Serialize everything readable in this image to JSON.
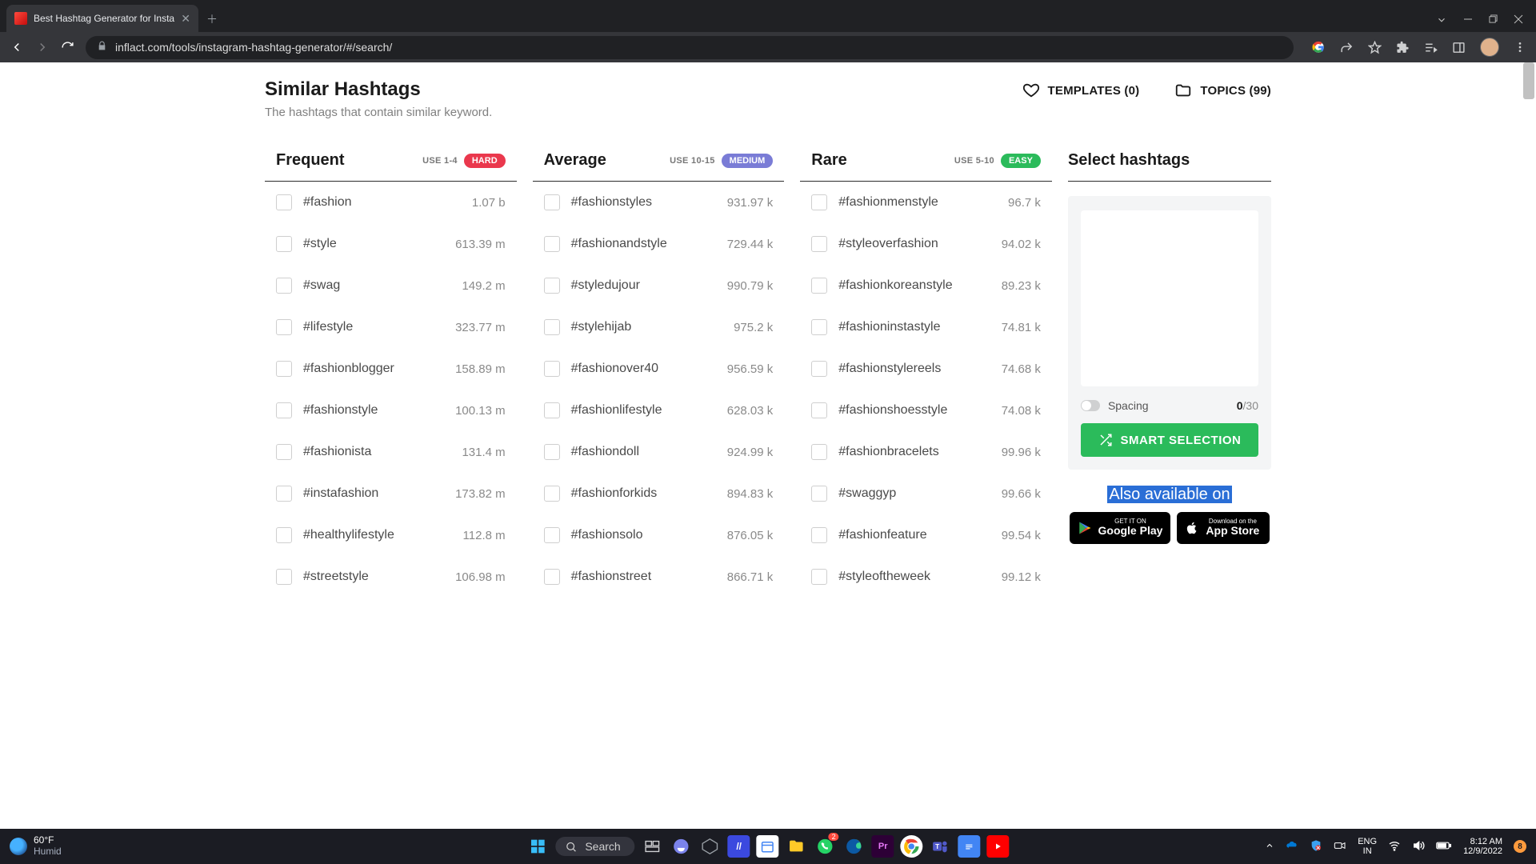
{
  "browser": {
    "tab_title": "Best Hashtag Generator for Insta",
    "url": "inflact.com/tools/instagram-hashtag-generator/#/search/"
  },
  "header": {
    "title": "Similar Hashtags",
    "subtitle": "The hashtags that contain similar keyword.",
    "templates_label": "TEMPLATES (0)",
    "topics_label": "TOPICS (99)"
  },
  "columns": {
    "frequent": {
      "title": "Frequent",
      "use": "USE 1-4",
      "badge": "HARD",
      "items": [
        {
          "tag": "#fashion",
          "count": "1.07 b"
        },
        {
          "tag": "#style",
          "count": "613.39 m"
        },
        {
          "tag": "#swag",
          "count": "149.2 m"
        },
        {
          "tag": "#lifestyle",
          "count": "323.77 m"
        },
        {
          "tag": "#fashionblogger",
          "count": "158.89 m"
        },
        {
          "tag": "#fashionstyle",
          "count": "100.13 m"
        },
        {
          "tag": "#fashionista",
          "count": "131.4 m"
        },
        {
          "tag": "#instafashion",
          "count": "173.82 m"
        },
        {
          "tag": "#healthylifestyle",
          "count": "112.8 m"
        },
        {
          "tag": "#streetstyle",
          "count": "106.98 m"
        }
      ]
    },
    "average": {
      "title": "Average",
      "use": "USE 10-15",
      "badge": "MEDIUM",
      "items": [
        {
          "tag": "#fashionstyles",
          "count": "931.97 k"
        },
        {
          "tag": "#fashionandstyle",
          "count": "729.44 k"
        },
        {
          "tag": "#styledujour",
          "count": "990.79 k"
        },
        {
          "tag": "#stylehijab",
          "count": "975.2 k"
        },
        {
          "tag": "#fashionover40",
          "count": "956.59 k"
        },
        {
          "tag": "#fashionlifestyle",
          "count": "628.03 k"
        },
        {
          "tag": "#fashiondoll",
          "count": "924.99 k"
        },
        {
          "tag": "#fashionforkids",
          "count": "894.83 k"
        },
        {
          "tag": "#fashionsolo",
          "count": "876.05 k"
        },
        {
          "tag": "#fashionstreet",
          "count": "866.71 k"
        }
      ]
    },
    "rare": {
      "title": "Rare",
      "use": "USE 5-10",
      "badge": "EASY",
      "items": [
        {
          "tag": "#fashionmenstyle",
          "count": "96.7 k"
        },
        {
          "tag": "#styleoverfashion",
          "count": "94.02 k"
        },
        {
          "tag": "#fashionkoreanstyle",
          "count": "89.23 k"
        },
        {
          "tag": "#fashioninstastyle",
          "count": "74.81 k"
        },
        {
          "tag": "#fashionstylereels",
          "count": "74.68 k"
        },
        {
          "tag": "#fashionshoesstyle",
          "count": "74.08 k"
        },
        {
          "tag": "#fashionbracelets",
          "count": "99.96 k"
        },
        {
          "tag": "#swaggyp",
          "count": "99.66 k"
        },
        {
          "tag": "#fashionfeature",
          "count": "99.54 k"
        },
        {
          "tag": "#styleoftheweek",
          "count": "99.12 k"
        }
      ]
    }
  },
  "side": {
    "title": "Select hashtags",
    "spacing_label": "Spacing",
    "count_current": "0",
    "count_max": "/30",
    "smart_button": "SMART SELECTION",
    "also_text": "Also available on",
    "google_top": "GET IT ON",
    "google_bottom": "Google Play",
    "apple_top": "Download on the",
    "apple_bottom": "App Store"
  },
  "taskbar": {
    "weather_temp": "60°F",
    "weather_desc": "Humid",
    "search": "Search",
    "lang_top": "ENG",
    "lang_bottom": "IN",
    "time": "8:12 AM",
    "date": "12/9/2022",
    "notif": "8"
  }
}
